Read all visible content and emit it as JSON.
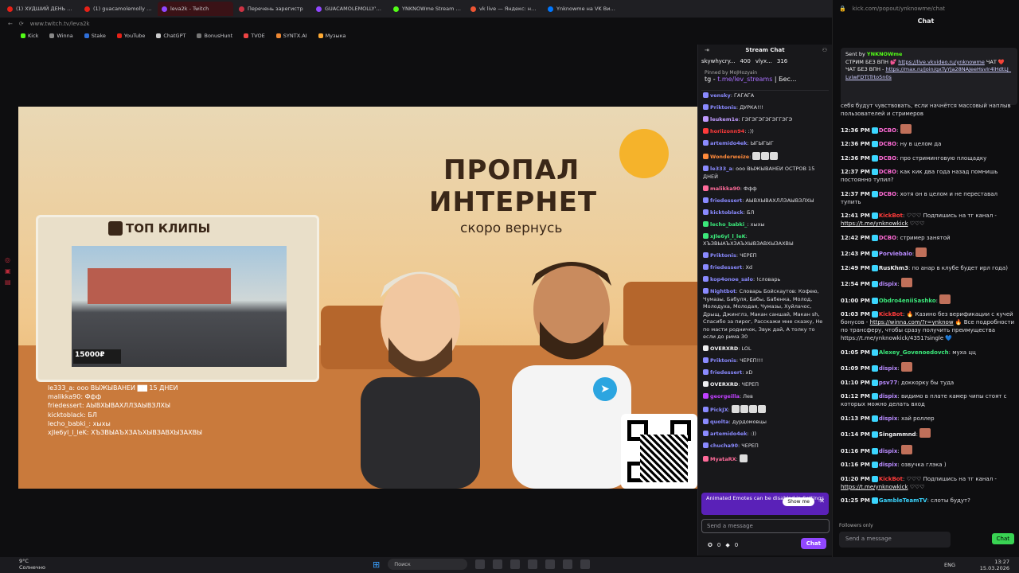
{
  "tabs": [
    {
      "label": "(1) ХУДШИЙ ДЕНЬ в АОН",
      "color": "#e62117"
    },
    {
      "label": "(1) guacamolemolly укус",
      "color": "#e62117"
    },
    {
      "label": "leva2k - Twitch",
      "color": "#9147ff",
      "active": true
    },
    {
      "label": "Перечень зарегистр",
      "color": "#cc3344"
    },
    {
      "label": "GUACAMOLEMOLLY's Vi",
      "color": "#9147ff"
    },
    {
      "label": "YNKNOWme Stream - Wa",
      "color": "#53fc18"
    },
    {
      "label": "vk live — Яндекс: нашёл",
      "color": "#e53"
    },
    {
      "label": "Ynknowme на VK Видео L",
      "color": "#0077ff"
    }
  ],
  "address": "www.twitch.tv/leva2k",
  "bookmarks": [
    {
      "label": "Kick",
      "color": "#53fc18"
    },
    {
      "label": "Winna",
      "color": "#888"
    },
    {
      "label": "Stake",
      "color": "#2f6fd9"
    },
    {
      "label": "YouTube",
      "color": "#e62117"
    },
    {
      "label": "ChatGPT",
      "color": "#ccc"
    },
    {
      "label": "BonusHunt",
      "color": "#777"
    },
    {
      "label": "TVOE",
      "color": "#e44"
    },
    {
      "label": "SYNTX.AI",
      "color": "#e83"
    },
    {
      "label": "Музыка",
      "color": "#fa3"
    }
  ],
  "video": {
    "title_line1": "ПРОПАЛ",
    "title_line2": "ИНТЕРНЕТ",
    "subtitle": "скоро вернусь",
    "clips_header": "ТОП КЛИПЫ",
    "price": "15000₽"
  },
  "overlay_chat": [
    "le333_a: ооо ВЫЖЫВАНЕИ ▇▇ 15 ДНЕИ",
    "malikka90: Ффф",
    "friedessert: АЫВХЫВАХЛЛЗАЫВЗЛХЫ",
    "kicktoblack: БЛ",
    "lecho_babki_: хыхы",
    "xJle6yl_l_leK: ХЪЗВЫАЪХЗАЪХЫВЗАВХЫЗАХВЫ"
  ],
  "stream_chat": {
    "header": "Stream Chat",
    "gift_user": "skywhycry...",
    "gift_count1": "400",
    "gift_user2": "vlyx...",
    "gift_count2": "316",
    "pinned_by": "Pinned by MoJHozyain",
    "pinned_text": "tg - ",
    "pinned_link": "t.me/lev_streams",
    "pinned_rest": " | Бес...",
    "messages": [
      {
        "user": "vensky",
        "text": "ГАГАГА",
        "color": "#8a8aff"
      },
      {
        "user": "Priktonis",
        "text": "ДУРКА!!!",
        "color": "#8a8aff"
      },
      {
        "user": "leukem1e",
        "text": "ГЭГЭГЭГЭГЭГГЭГЭ",
        "color": "#c09bff"
      },
      {
        "user": "horiizonn94",
        "text": ":))",
        "color": "#ff3b3b"
      },
      {
        "user": "artemido4ek",
        "text": "ЫГЫГЫГ",
        "color": "#8a8aff"
      },
      {
        "user": "Wonderweize",
        "text": "",
        "color": "#ff8a3b",
        "emotes": 3
      },
      {
        "user": "le333_a",
        "text": "ооо ВЫЖЫВАНЕИ ОСТРОВ 15 ДНЕЙ",
        "color": "#8a8aff"
      },
      {
        "user": "malikka90",
        "text": "Ффф",
        "color": "#ff6b9a"
      },
      {
        "user": "friedessert",
        "text": "АЫВХЫВАХЛЛЗАЫВЗЛХЫ",
        "color": "#8a8aff"
      },
      {
        "user": "kicktoblack",
        "text": "БЛ",
        "color": "#8a8aff"
      },
      {
        "user": "lecho_babki_",
        "text": "хыхы",
        "color": "#3be87a"
      },
      {
        "user": "xJle6yl_l_leK",
        "text": "ХЪЗВЫАЪХЗАЪХЫВЗАВХЫЗАХВЫ",
        "color": "#3be87a"
      },
      {
        "user": "Priktonis",
        "text": "ЧЕРЕП",
        "color": "#8a8aff"
      },
      {
        "user": "friedessert",
        "text": "Xd",
        "color": "#8a8aff"
      },
      {
        "user": "kop4onoe_salo",
        "text": "!словарь",
        "color": "#8a8aff"
      },
      {
        "user": "Nightbot",
        "text": "Словарь Бойскаутов: Кофею, Чумазы, Бабуля, Бабы, Бабенка, Молод, Молодуха, Молодая, Чумазы, Хуйлачос, Дрыщ, Джинглз, Макан саншай, Макан sh, Спасибо за пирог, Расскажи мне сказку, Не по масти родничок, Звук дай, А толку то если до рима 30",
        "color": "#8a8aff"
      },
      {
        "user": "OVERXRD",
        "text": "LOL",
        "color": "#efeff1"
      },
      {
        "user": "Priktonis",
        "text": "ЧЕРЕП!!!",
        "color": "#8a8aff"
      },
      {
        "user": "friedessert",
        "text": "xD",
        "color": "#8a8aff"
      },
      {
        "user": "OVERXRD",
        "text": "ЧЕРЕП",
        "color": "#efeff1"
      },
      {
        "user": "georgeilla",
        "text": "Лев",
        "color": "#c040ff"
      },
      {
        "user": "PickJX",
        "text": "",
        "color": "#8a8aff",
        "emotes": 4
      },
      {
        "user": "quolta",
        "text": "дурдомовцы",
        "color": "#8a8aff"
      },
      {
        "user": "artemido4ek",
        "text": ":))",
        "color": "#8a8aff"
      },
      {
        "user": "chucha90",
        "text": "ЧЕРЕП",
        "color": "#8a8aff"
      },
      {
        "user": "MyataRX",
        "text": "",
        "color": "#ff6b9a",
        "emotes": 1
      }
    ],
    "notice_text": "Animated Emotes can be disabled in Settings",
    "notice_button": "Show me",
    "input_placeholder": "Send a message",
    "points1": "0",
    "points2": "0",
    "chat_button": "Chat"
  },
  "popout": {
    "url": "kick.com/popout/ynknowme/chat",
    "title": "Chat",
    "pin": {
      "sent_by": "Sent by",
      "sender": "YNKNOWme",
      "text1": "СТРИМ БЕЗ ВПН 💕 ",
      "link1": "https://live.vkvideo.ru/ynknowme",
      "text2": " ЧАТ ❤️ ЧАТ БЕЗ ВПН - ",
      "link2": "https://max.ru/join/gxTyYJa28NAJeeHsvIr4lHdtLJ_LviwFDTtTrto5n0s",
      "pinned_by": "Pinned by",
      "pinner": "YNKNOWme",
      "time": "at 11:26 AM"
    },
    "partial": "себя будут чувствовать, если начнётся массовый наплыв пользователей и стримеров",
    "messages": [
      {
        "time": "12:36 PM",
        "user": "DCBO",
        "text": "",
        "color": "#ff6bd6",
        "emote": true
      },
      {
        "time": "12:36 PM",
        "user": "DCBO",
        "text": "ну в целом да",
        "color": "#ff6bd6"
      },
      {
        "time": "12:36 PM",
        "user": "DCBO",
        "text": "про стриминговую площадку",
        "color": "#ff6bd6"
      },
      {
        "time": "12:37 PM",
        "user": "DCBO",
        "text": "как кик два года назад помнишь постоянно тупил?",
        "color": "#ff6bd6"
      },
      {
        "time": "12:37 PM",
        "user": "DCBO",
        "text": "хотя он в целом и не переставал тупить",
        "color": "#ff6bd6"
      },
      {
        "time": "12:41 PM",
        "user": "KickBot",
        "text": "♡♡♡ Подпишись на тг канал - ",
        "link": "https://t.me/ynknowkick",
        "tail": " ♡♡♡",
        "color": "#ff3b3b"
      },
      {
        "time": "12:42 PM",
        "user": "DCBO",
        "text": "стример занятой",
        "color": "#ff6bd6"
      },
      {
        "time": "12:43 PM",
        "user": "Porviebalo",
        "text": "",
        "color": "#b98bff",
        "emote": true
      },
      {
        "time": "12:49 PM",
        "user": "RusKhm3",
        "text": "по анар в клубе будет ирл года)",
        "color": "#efeff1"
      },
      {
        "time": "12:54 PM",
        "user": "dispix",
        "text": "",
        "color": "#b98bff",
        "emote": true
      },
      {
        "time": "01:00 PM",
        "user": "Obdro4eniiSashko",
        "text": "",
        "color": "#3be87a",
        "emote": true
      },
      {
        "time": "01:03 PM",
        "user": "KickBot",
        "text": "🔥 Казино без верификации с кучей бонусов - ",
        "link": "https://winna.com/?r=ynknow",
        "tail": " 🔥 Все подробности по трансферу, чтобы сразу получить преимущества https://t.me/ynknowkick/4351?single 💙",
        "color": "#ff3b3b"
      },
      {
        "time": "01:05 PM",
        "user": "Alexey_Govenoedovch",
        "text": "муха цц",
        "color": "#3be87a"
      },
      {
        "time": "01:09 PM",
        "user": "dispix",
        "text": "",
        "color": "#b98bff",
        "emote": true
      },
      {
        "time": "01:10 PM",
        "user": "psv77",
        "text": "доккорку бы туда",
        "color": "#b98bff"
      },
      {
        "time": "01:12 PM",
        "user": "dispix",
        "text": "видимо в плате камер чипы стоят с которых можно делать вход",
        "color": "#b98bff"
      },
      {
        "time": "01:13 PM",
        "user": "dispix",
        "text": "хай роллер",
        "color": "#b98bff"
      },
      {
        "time": "01:14 PM",
        "user": "Singammnd",
        "text": "",
        "color": "#efeff1",
        "emote": true
      },
      {
        "time": "01:16 PM",
        "user": "dispix",
        "text": "",
        "color": "#b98bff",
        "emote": true
      },
      {
        "time": "01:16 PM",
        "user": "dispix",
        "text": "озвучка глэка )",
        "color": "#b98bff"
      },
      {
        "time": "01:20 PM",
        "user": "KickBot",
        "text": "♡♡♡ Подпишись на тг канал - ",
        "link": "https://t.me/ynknowkick",
        "tail": " ♡♡♡",
        "color": "#ff3b3b"
      },
      {
        "time": "01:25 PM",
        "user": "GambleTeamTV",
        "text": "слоты будут?",
        "color": "#3bd6ff"
      }
    ],
    "followers_only": "Followers only",
    "input_placeholder": "Send a message",
    "chat_button": "Chat"
  },
  "taskbar": {
    "temp": "9°C",
    "weather": "Солнечно",
    "search": "Поиск",
    "lang": "ENG",
    "time": "13:27",
    "date": "15.03.2026"
  }
}
